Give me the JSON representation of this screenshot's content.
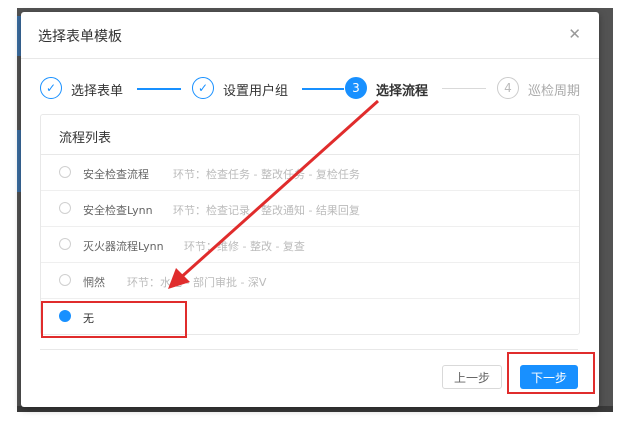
{
  "modal": {
    "title": "选择表单模板",
    "close_glyph": "✕"
  },
  "steps": [
    {
      "label": "选择表单",
      "status": "done",
      "glyph": "✓"
    },
    {
      "label": "设置用户组",
      "status": "done",
      "glyph": "✓"
    },
    {
      "label": "选择流程",
      "status": "active",
      "glyph": "3"
    },
    {
      "label": "巡检周期",
      "status": "pending",
      "glyph": "4"
    }
  ],
  "panel": {
    "title": "流程列表",
    "rows": [
      {
        "name": "安全检查流程",
        "steps": "环节：检查任务 - 整改任务 - 复检任务",
        "selected": false
      },
      {
        "name": "安全检查Lynn",
        "steps": "环节：检查记录 - 整改通知 - 结果回复",
        "selected": false
      },
      {
        "name": "灭火器流程Lynn",
        "steps": "环节：维修 - 整改 - 复查",
        "selected": false
      },
      {
        "name": "惘然",
        "steps": "环节：水电 - 部门审批 - 深V",
        "selected": false
      },
      {
        "name": "无",
        "steps": "",
        "selected": true
      }
    ]
  },
  "footer": {
    "prev_label": "上一步",
    "next_label": "下一步"
  },
  "colors": {
    "accent": "#1890ff",
    "annotation": "#e02c2c"
  }
}
